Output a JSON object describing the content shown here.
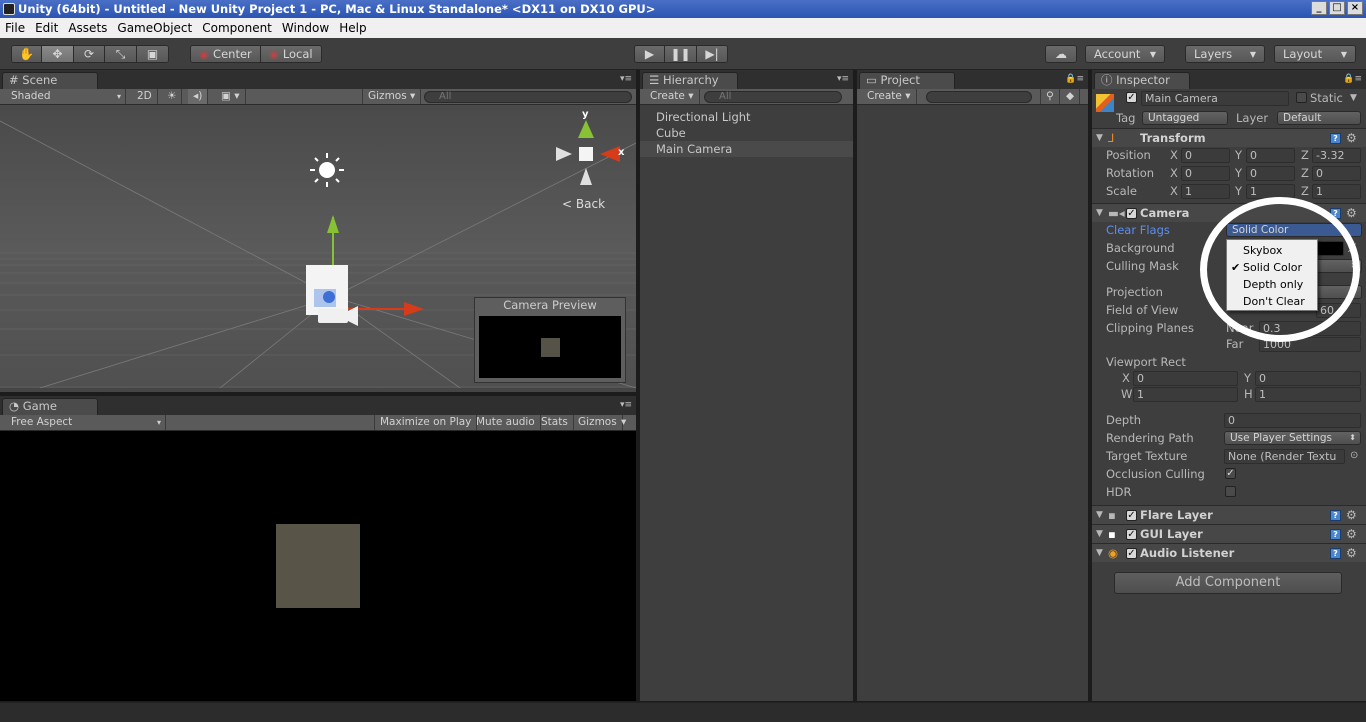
{
  "window": {
    "title": "Unity (64bit) - Untitled - New Unity Project 1 - PC, Mac & Linux Standalone* <DX11 on DX10 GPU>"
  },
  "menubar": [
    "File",
    "Edit",
    "Assets",
    "GameObject",
    "Component",
    "Window",
    "Help"
  ],
  "toolbar": {
    "pivot": "Center",
    "space": "Local",
    "account": "Account",
    "layers": "Layers",
    "layout": "Layout"
  },
  "scene": {
    "tab": "Scene",
    "shading": "Shaded",
    "mode2d": "2D",
    "gizmos": "Gizmos",
    "search_placeholder": "All",
    "gizmo_back": "Back",
    "axis_y": "y",
    "axis_x": "x",
    "camera_preview_title": "Camera Preview"
  },
  "game": {
    "tab": "Game",
    "aspect": "Free Aspect",
    "maximize": "Maximize on Play",
    "mute": "Mute audio",
    "stats": "Stats",
    "gizmos": "Gizmos"
  },
  "hierarchy": {
    "tab": "Hierarchy",
    "create": "Create",
    "search_placeholder": "All",
    "items": [
      {
        "label": "Directional Light",
        "selected": false
      },
      {
        "label": "Cube",
        "selected": false
      },
      {
        "label": "Main Camera",
        "selected": true
      }
    ]
  },
  "project": {
    "tab": "Project",
    "create": "Create"
  },
  "inspector": {
    "tab": "Inspector",
    "object_name": "Main Camera",
    "static_label": "Static",
    "tag_label": "Tag",
    "tag_value": "Untagged",
    "layer_label": "Layer",
    "layer_value": "Default",
    "transform": {
      "title": "Transform",
      "rows": [
        {
          "label": "Position",
          "x": "0",
          "y": "0",
          "z": "-3.32"
        },
        {
          "label": "Rotation",
          "x": "0",
          "y": "0",
          "z": "0"
        },
        {
          "label": "Scale",
          "x": "1",
          "y": "1",
          "z": "1"
        }
      ],
      "axis_x": "X",
      "axis_y": "Y",
      "axis_z": "Z"
    },
    "camera": {
      "title": "Camera",
      "clear_flags_label": "Clear Flags",
      "clear_flags_value": "Solid Color",
      "background_label": "Background",
      "culling_mask_label": "Culling Mask",
      "projection_label": "Projection",
      "fov_label": "Field of View",
      "fov_value": "60",
      "clipping_label": "Clipping Planes",
      "near_label": "Near",
      "near_value": "0.3",
      "far_label": "Far",
      "far_value": "1000",
      "viewport_label": "Viewport Rect",
      "vp_x_label": "X",
      "vp_x": "0",
      "vp_y_label": "Y",
      "vp_y": "0",
      "vp_w_label": "W",
      "vp_w": "1",
      "vp_h_label": "H",
      "vp_h": "1",
      "depth_label": "Depth",
      "depth_value": "0",
      "rendering_path_label": "Rendering Path",
      "rendering_path_value": "Use Player Settings",
      "target_texture_label": "Target Texture",
      "target_texture_value": "None (Render Textu",
      "occlusion_label": "Occlusion Culling",
      "hdr_label": "HDR"
    },
    "components": [
      {
        "title": "Flare Layer"
      },
      {
        "title": "GUI Layer"
      },
      {
        "title": "Audio Listener"
      }
    ],
    "add_component": "Add Component",
    "clear_flags_menu": [
      {
        "label": "Skybox",
        "checked": false
      },
      {
        "label": "Solid Color",
        "checked": true
      },
      {
        "label": "Depth only",
        "checked": false
      },
      {
        "label": "Don't Clear",
        "checked": false
      }
    ]
  },
  "colors": {
    "selection_blue": "#3d6fd6",
    "highlight_label": "#5c8ef0",
    "sun": "#ffffff"
  }
}
